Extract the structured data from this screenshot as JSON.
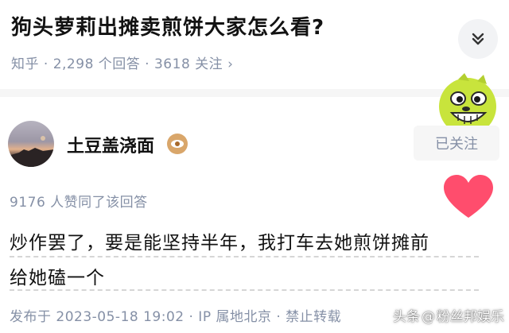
{
  "question": {
    "title": "狗头萝莉出摊卖煎饼大家怎么看?",
    "meta": "知乎 · 2,298 个回答 · 3618 关注 ›"
  },
  "author": {
    "name": "土豆盖浇面",
    "follow_label": "已关注"
  },
  "answer": {
    "likes_text": "9176 人赞同了该回答",
    "line1": "炒作罢了，要是能坚持半年，我打车去她煎饼摊前",
    "line2": "给她磕一个",
    "footer": "发布于 2023-05-18 19:02 · IP 属地北京 · 禁止转载"
  },
  "watermark": {
    "source": "头条",
    "at": "@",
    "account": "粉丝邦娱乐"
  },
  "colors": {
    "heart": "#ff4d6d",
    "meta_gray": "#8590a6",
    "sticker_yellow": "#c8e43c"
  },
  "icons": {
    "collapse": "chevron-down-double",
    "badge": "eye-badge",
    "like": "heart"
  }
}
